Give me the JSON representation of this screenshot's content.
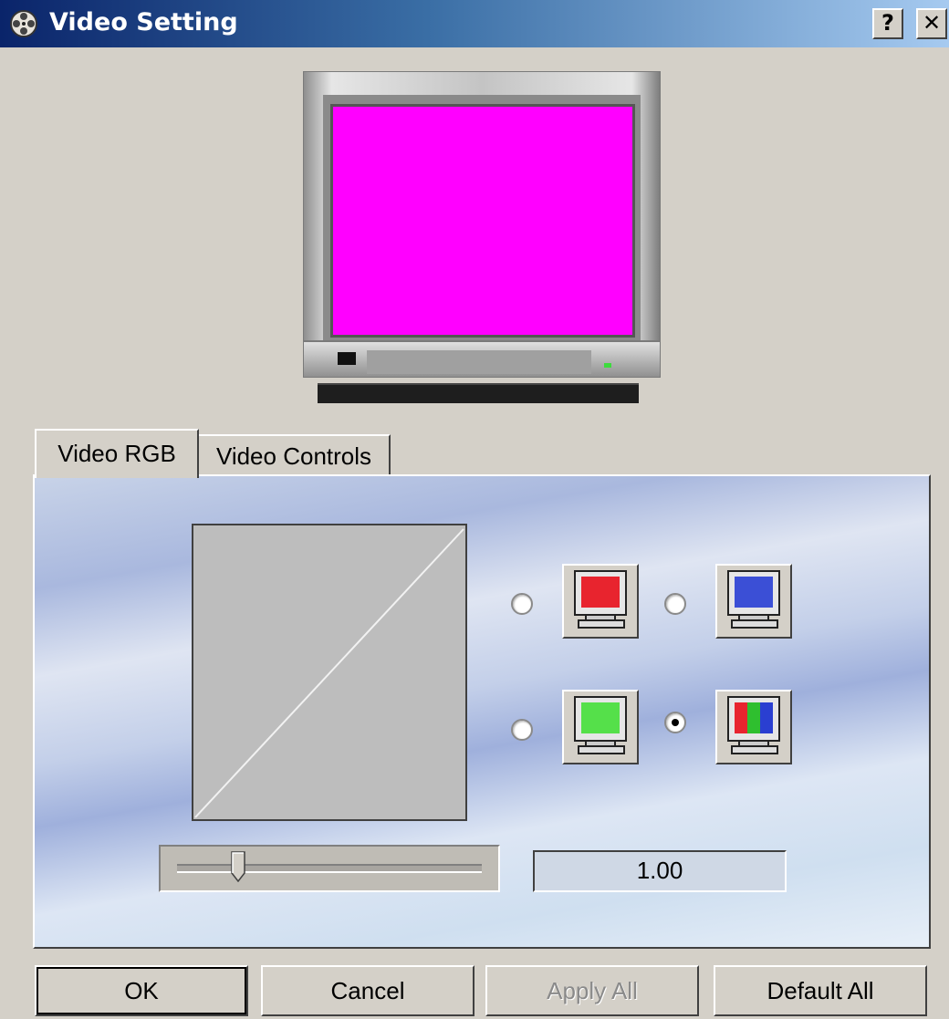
{
  "window": {
    "title": "Video Setting",
    "help_label": "?",
    "close_label": "✕",
    "app_icon": "film-reel-icon"
  },
  "preview": {
    "screen_color": "#ff00ff"
  },
  "tabs": [
    {
      "label": "Video RGB",
      "active": true
    },
    {
      "label": "Video Controls",
      "active": false
    }
  ],
  "rgb": {
    "channels": [
      {
        "name": "red",
        "icon": "red-monitor-icon",
        "color": "#e8242e",
        "selected": false
      },
      {
        "name": "blue",
        "icon": "blue-monitor-icon",
        "color": "#3b4fd6",
        "selected": false
      },
      {
        "name": "green",
        "icon": "green-monitor-icon",
        "color": "#55e04a",
        "selected": false
      },
      {
        "name": "all",
        "icon": "rgb-monitor-icon",
        "colors": [
          "#e8242e",
          "#2fbf2f",
          "#2a3fd1"
        ],
        "selected": true
      }
    ],
    "gamma_value": "1.00",
    "slider_fraction": 0.2
  },
  "buttons": {
    "ok": "OK",
    "cancel": "Cancel",
    "apply_all": "Apply All",
    "default_all": "Default All"
  }
}
